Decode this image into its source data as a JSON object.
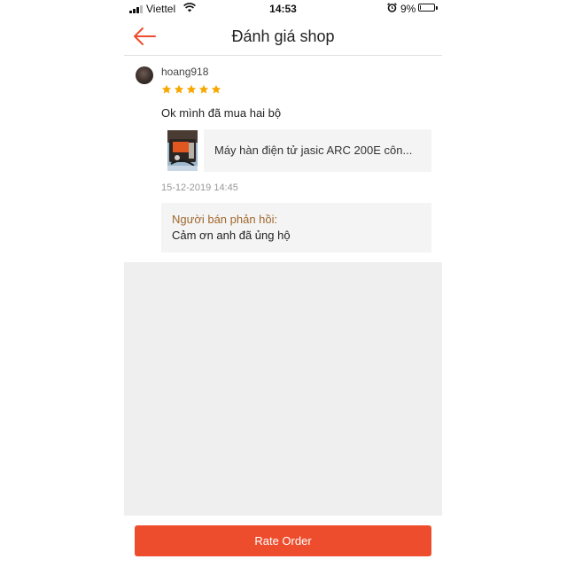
{
  "status_bar": {
    "carrier": "Viettel",
    "time": "14:53",
    "battery_percent": "9%",
    "battery_level": 0.09,
    "icons": [
      "signal-icon",
      "wifi-icon",
      "alarm-icon",
      "battery-icon"
    ]
  },
  "header": {
    "title": "Đánh giá shop",
    "back_icon": "arrow-left-icon"
  },
  "review": {
    "username": "hoang918",
    "rating": 5,
    "comment": "Ok mình đã mua hai bộ",
    "product_name": "Máy hàn điện tử jasic ARC 200E côn...",
    "timestamp": "15-12-2019 14:45",
    "seller_reply_label": "Người bán phản hồi:",
    "seller_reply_text": "Cảm ơn anh đã ủng hộ"
  },
  "footer": {
    "rate_button_label": "Rate Order"
  },
  "colors": {
    "accent": "#ee4d2d",
    "star": "#f6a700",
    "reply_label": "#a0682d",
    "empty_area": "#efefef"
  }
}
